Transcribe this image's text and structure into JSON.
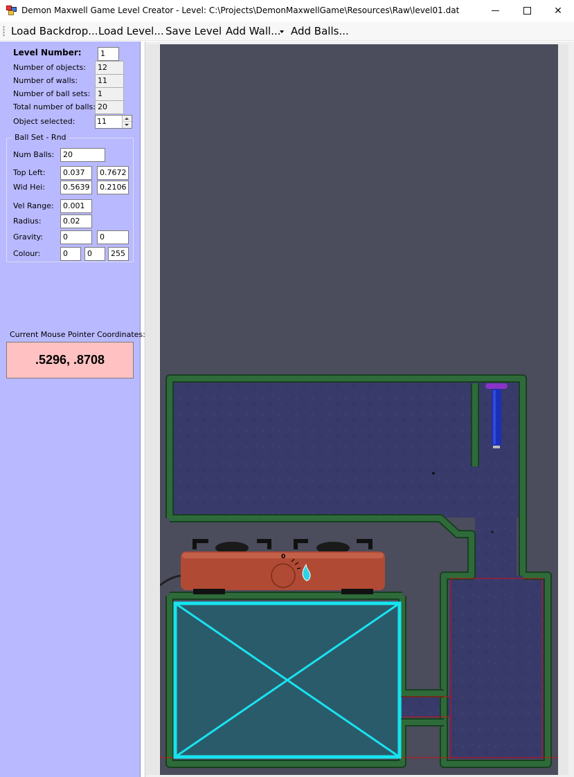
{
  "window": {
    "title": "Demon Maxwell Game Level Creator - Level: C:\\Projects\\DemonMaxwellGame\\Resources\\Raw\\level01.dat",
    "min_glyph": "",
    "close_glyph": "✕"
  },
  "menu": {
    "load_backdrop": "Load Backdrop...",
    "load_level": "Load Level...",
    "save_level": "Save Level",
    "add_wall": "Add Wall...",
    "add_balls": "Add Balls..."
  },
  "panel": {
    "level_number_label": "Level Number:",
    "level_number_value": "1",
    "num_objects_label": "Number of objects:",
    "num_objects_value": "12",
    "num_walls_label": "Number of walls:",
    "num_walls_value": "11",
    "num_ball_sets_label": "Number of ball sets:",
    "num_ball_sets_value": "1",
    "total_balls_label": "Total number of balls:",
    "total_balls_value": "20",
    "object_selected_label": "Object selected:",
    "object_selected_value": "11"
  },
  "ballset": {
    "title": "Ball Set  - Rnd",
    "num_balls_label": "Num Balls:",
    "num_balls_value": "20",
    "top_left_label": "Top Left:",
    "top_left_x": "0.037",
    "top_left_y": "0.7672",
    "wid_hei_label": "Wid Hei:",
    "wid": "0.5639",
    "hei": "0.2106",
    "vel_range_label": "Vel Range:",
    "vel_range_value": "0.001",
    "radius_label": "Radius:",
    "radius_value": "0.02",
    "gravity_label": "Gravity:",
    "gravity_x": "0",
    "gravity_y": "0",
    "colour_label": "Colour:",
    "colour_r": "0",
    "colour_g": "0",
    "colour_b": "255"
  },
  "mouse": {
    "label": "Current Mouse Pointer Coordinates:",
    "coords": ".5296, .8708"
  },
  "level_view": {
    "stove_dial_mark": "0",
    "colors": {
      "background": "#4b4c5c",
      "chamber_fill": "#383a6a",
      "wall": "#2f6b3a",
      "wall_edge": "#16401f",
      "selection": "#19e3f0",
      "stove": "#b04a34",
      "piston": "#1b2fb8",
      "piston_cap": "#8a33c9",
      "boundary_line": "#cc1111"
    }
  }
}
